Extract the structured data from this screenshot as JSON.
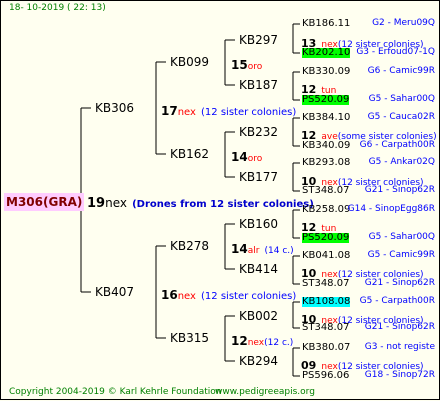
{
  "header": {
    "date": "18- 10-2019 (  22:  13)"
  },
  "root": {
    "id": "M306(GRA)",
    "num": "19",
    "tag": "nex",
    "note": "(Drones from 12 sister colonies)"
  },
  "gen1": [
    {
      "id": "KB306",
      "num": "17",
      "tag": "nex",
      "note": "(12 sister colonies)"
    },
    {
      "id": "KB407",
      "num": "16",
      "tag": "nex",
      "note": "(12 sister colonies)"
    }
  ],
  "gen2": [
    {
      "id": "KB099",
      "num": "15",
      "tag": "oro"
    },
    {
      "id": "KB162",
      "num": "14",
      "tag": "oro"
    },
    {
      "id": "KB278",
      "num": "14",
      "tag": "alr",
      "note": "(14 c.)"
    },
    {
      "id": "KB315",
      "num": "12",
      "tag": "nex",
      "note": "(12 c.)"
    }
  ],
  "gen3": [
    {
      "id": "KB297",
      "num": "13",
      "tag": "nex",
      "note": "(12 sister colonies)"
    },
    {
      "id": "KB187",
      "num": "12",
      "tag": "tun"
    },
    {
      "id": "KB232",
      "num": "12",
      "tag": "ave",
      "note": "(some sister colonies)"
    },
    {
      "id": "KB177",
      "num": "10",
      "tag": "nex",
      "note": "(12 sister colonies)"
    },
    {
      "id": "KB160",
      "num": "12",
      "tag": "tun"
    },
    {
      "id": "KB414",
      "num": "10",
      "tag": "nex",
      "note": "(12 sister colonies)"
    },
    {
      "id": "KB002",
      "num": "10",
      "tag": "nex",
      "note": "(12 sister colonies)"
    },
    {
      "id": "KB294",
      "num": "09",
      "tag": "nex",
      "note": "(12 sister colonies)"
    }
  ],
  "gen4": [
    {
      "id": "KB186.11",
      "right": "G2 - Meru09Q"
    },
    {
      "id": "KB202.10",
      "right": "G3 - Erfoud07-1Q",
      "hl": "green"
    },
    {
      "id": "KB330.09",
      "right": "G6 - Camic99R"
    },
    {
      "id": "PS520.09",
      "right": "G5 - Sahar00Q",
      "hl": "green"
    },
    {
      "id": "KB384.10",
      "right": "G5 - Cauca02R"
    },
    {
      "id": "KB340.09",
      "right": "G6 - Carpath00R"
    },
    {
      "id": "KB293.08",
      "right": "G5 - Ankar02Q"
    },
    {
      "id": "ST348.07",
      "right": "G21 - Sinop62R"
    },
    {
      "id": "KB258.09",
      "right": "G14 - SinopEgg86R"
    },
    {
      "id": "PS520.09",
      "right": "G5 - Sahar00Q",
      "hl": "green"
    },
    {
      "id": "KB041.08",
      "right": "G5 - Camic99R"
    },
    {
      "id": "ST348.07",
      "right": "G21 - Sinop62R"
    },
    {
      "id": "KB108.08",
      "right": "G5 - Carpath00R",
      "hl": "cyan"
    },
    {
      "id": "ST348.07",
      "right": "G21 - Sinop62R"
    },
    {
      "id": "KB380.07",
      "right": "G3 - not registe"
    },
    {
      "id": "PS596.06",
      "right": "G18 - Sinop72R"
    }
  ],
  "footer": {
    "copyright": "Copyright 2004-2019 © Karl Kehrle Foundation",
    "url": "www.pedigreeapis.org"
  }
}
